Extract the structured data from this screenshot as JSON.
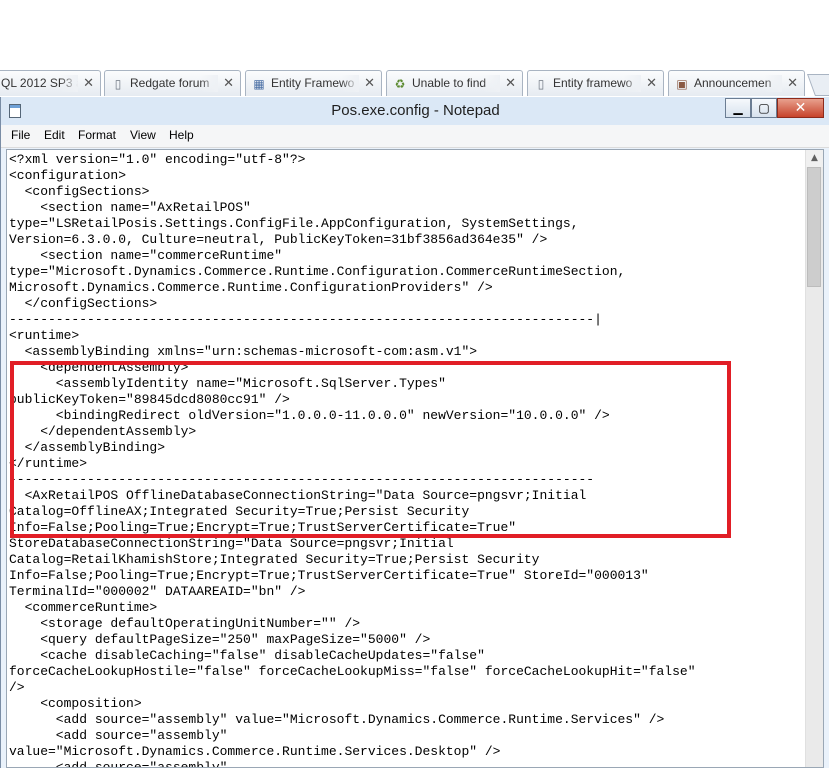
{
  "browser": {
    "tabs": [
      {
        "title": "QL 2012 SP3 a",
        "icon": "page-icon"
      },
      {
        "title": "Redgate forum",
        "icon": "page-icon"
      },
      {
        "title": "Entity Framewo",
        "icon": "calendar-icon"
      },
      {
        "title": "Unable to find",
        "icon": "recycle-icon"
      },
      {
        "title": "Entity framewo",
        "icon": "page-icon"
      },
      {
        "title": "Announcemen",
        "icon": "building-icon"
      }
    ],
    "close_glyph": "✕"
  },
  "window": {
    "title": "Pos.exe.config - Notepad",
    "min_glyph": "▁",
    "max_glyph": "▢",
    "close_glyph": "✕"
  },
  "menu": [
    "File",
    "Edit",
    "Format",
    "View",
    "Help"
  ],
  "editor": {
    "lines": [
      "<?xml version=\"1.0\" encoding=\"utf-8\"?>",
      "<configuration>",
      "  <configSections>",
      "    <section name=\"AxRetailPOS\"",
      "type=\"LSRetailPosis.Settings.ConfigFile.AppConfiguration, SystemSettings,",
      "Version=6.3.0.0, Culture=neutral, PublicKeyToken=31bf3856ad364e35\" />",
      "    <section name=\"commerceRuntime\"",
      "type=\"Microsoft.Dynamics.Commerce.Runtime.Configuration.CommerceRuntimeSection,",
      "Microsoft.Dynamics.Commerce.Runtime.ConfigurationProviders\" />",
      "  </configSections>",
      "---------------------------------------------------------------------------|",
      "<runtime>",
      "  <assemblyBinding xmlns=\"urn:schemas-microsoft-com:asm.v1\">",
      "    <dependentAssembly>",
      "      <assemblyIdentity name=\"Microsoft.SqlServer.Types\"",
      "publicKeyToken=\"89845dcd8080cc91\" />",
      "      <bindingRedirect oldVersion=\"1.0.0.0-11.0.0.0\" newVersion=\"10.0.0.0\" />",
      "    </dependentAssembly>",
      "  </assemblyBinding>",
      "</runtime>",
      "---------------------------------------------------------------------------",
      "  <AxRetailPOS OfflineDatabaseConnectionString=\"Data Source=pngsvr;Initial",
      "Catalog=OfflineAX;Integrated Security=True;Persist Security",
      "Info=False;Pooling=True;Encrypt=True;TrustServerCertificate=True\"",
      "StoreDatabaseConnectionString=\"Data Source=pngsvr;Initial",
      "Catalog=RetailKhamishStore;Integrated Security=True;Persist Security",
      "Info=False;Pooling=True;Encrypt=True;TrustServerCertificate=True\" StoreId=\"000013\"",
      "TerminalId=\"000002\" DATAAREAID=\"bn\" />",
      "  <commerceRuntime>",
      "    <storage defaultOperatingUnitNumber=\"\" />",
      "    <query defaultPageSize=\"250\" maxPageSize=\"5000\" />",
      "    <cache disableCaching=\"false\" disableCacheUpdates=\"false\"",
      "forceCacheLookupHostile=\"false\" forceCacheLookupMiss=\"false\" forceCacheLookupHit=\"false\"",
      "/>",
      "    <composition>",
      "      <add source=\"assembly\" value=\"Microsoft.Dynamics.Commerce.Runtime.Services\" />",
      "      <add source=\"assembly\"",
      "value=\"Microsoft.Dynamics.Commerce.Runtime.Services.Desktop\" />",
      "      <add source=\"assembly\""
    ]
  },
  "scrollbar": {
    "up_glyph": "▲",
    "grip_glyph": "≡"
  },
  "colors": {
    "highlight": "#e11e26",
    "titlebar": "#dbe8f6",
    "close_button": "#c7432b"
  }
}
